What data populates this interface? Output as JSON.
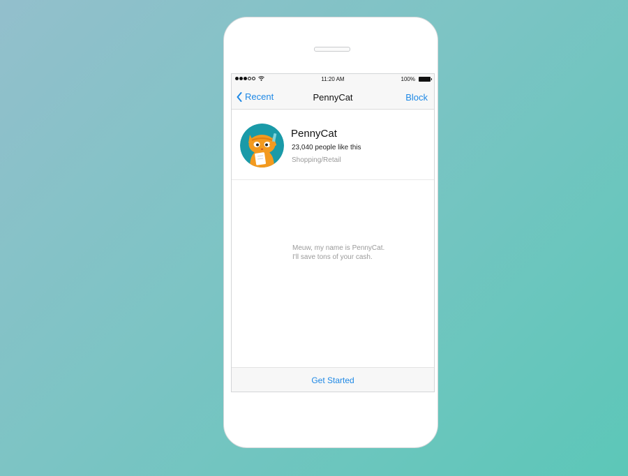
{
  "statusbar": {
    "signal_icon": "signal-dots-icon",
    "wifi_icon": "wifi-icon",
    "time": "11:20 AM",
    "battery": "100%",
    "battery_icon": "battery-icon"
  },
  "navbar": {
    "back_label": "Recent",
    "back_icon": "chevron-left-icon",
    "title": "PennyCat",
    "action_label": "Block"
  },
  "profile": {
    "name": "PennyCat",
    "likes": "23,040 people like this",
    "category": "Shopping/Retail",
    "avatar_icon": "cat-avatar-icon"
  },
  "message": {
    "line1": "Meuw, my name is PennyCat.",
    "line2": "I'll save tons of your cash."
  },
  "footer": {
    "cta_label": "Get Started"
  },
  "colors": {
    "accent": "#1e88e5",
    "avatar_bg": "#1a9aa8",
    "cat": "#f39a1f"
  }
}
